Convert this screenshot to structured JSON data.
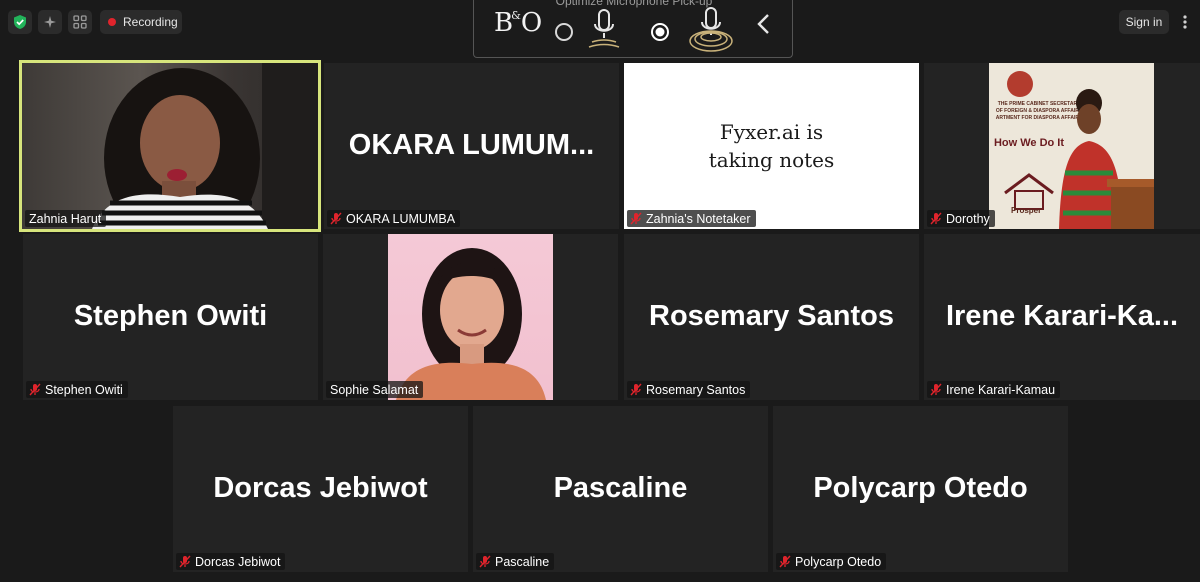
{
  "topbar": {
    "shield_icon": "shield-check-icon",
    "ai_icon": "sparkle-icon",
    "grid_icon": "grid-icon",
    "recording_label": "Recording",
    "signin_label": "Sign in",
    "more_icon": "more-vertical-icon"
  },
  "bo_panel": {
    "title": "Optimize Microphone Pick-up",
    "logo": "B&O",
    "options": [
      "omni-microphone",
      "directional-microphone"
    ],
    "selected": "directional-microphone"
  },
  "participants": [
    {
      "id": "zahnia",
      "label": "Zahnia Harut",
      "video": true,
      "muted": false,
      "active": true
    },
    {
      "id": "okara",
      "big": "OKARA  LUMUM...",
      "label": "OKARA LUMUMBA",
      "muted": true
    },
    {
      "id": "notetaker",
      "card_line1": "Fyxer.ai is",
      "card_line2": "taking notes",
      "label": "Zahnia's Notetaker",
      "muted": true
    },
    {
      "id": "dorothy",
      "label": "Dorothy",
      "video": true,
      "muted": true,
      "banner_line1": "THE PRIME CABINET SECRETARY",
      "banner_line2": "OF FOREIGN & DIASPORA AFFAIRS",
      "banner_line3": "ARTMENT FOR DIASPORA AFFAIRS",
      "banner_heading": "How We Do It",
      "banner_footer": "Prosper"
    },
    {
      "id": "stephen",
      "big": "Stephen Owiti",
      "label": "Stephen Owiti",
      "muted": true
    },
    {
      "id": "sophie",
      "label": "Sophie Salamat",
      "video": true,
      "muted": false
    },
    {
      "id": "rosemary",
      "big": "Rosemary Santos",
      "label": "Rosemary Santos",
      "muted": true
    },
    {
      "id": "irene",
      "big": "Irene  Karari-Ka...",
      "label": "Irene Karari-Kamau",
      "muted": true
    },
    {
      "id": "dorcas",
      "big": "Dorcas Jebiwot",
      "label": "Dorcas Jebiwot",
      "muted": true
    },
    {
      "id": "pascaline",
      "big": "Pascaline",
      "label": "Pascaline",
      "muted": true
    },
    {
      "id": "polycarp",
      "big": "Polycarp Otedo",
      "label": "Polycarp Otedo",
      "muted": true
    }
  ],
  "colors": {
    "background": "#1a1a1a",
    "tile": "#232323",
    "active_speaker_border": "#d7e57c",
    "muted_icon": "#e0242c",
    "recording_dot": "#e0242c",
    "shield": "#22b35a"
  }
}
